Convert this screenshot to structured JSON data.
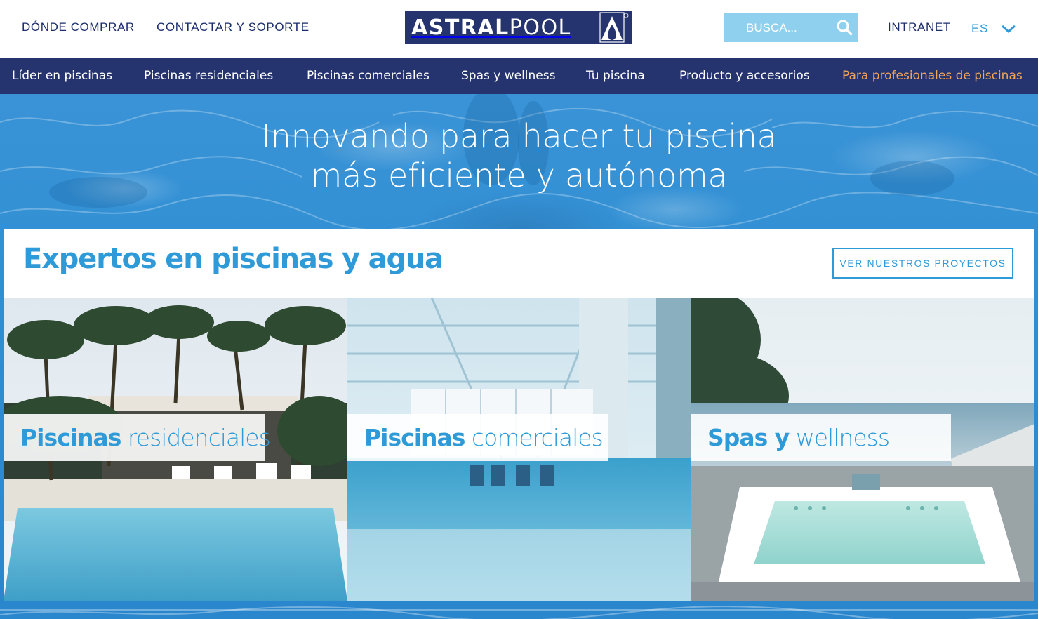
{
  "header": {
    "where_to_buy": "DÓNDE COMPRAR",
    "contact": "CONTACTAR Y SOPORTE",
    "logo": {
      "word_bold": "ASTRAL",
      "word_light": "POOL"
    },
    "search": {
      "placeholder": "BUSCA...",
      "icon": "search-icon"
    },
    "intranet": "INTRANET",
    "language": {
      "selected": "ES",
      "icon": "chevron-down-icon"
    }
  },
  "nav": {
    "items": [
      {
        "label": "Líder en piscinas"
      },
      {
        "label": "Piscinas residenciales"
      },
      {
        "label": "Piscinas comerciales"
      },
      {
        "label": "Spas y wellness"
      },
      {
        "label": "Tu piscina"
      },
      {
        "label": "Producto y accesorios"
      },
      {
        "label": "Para profesionales de piscinas"
      }
    ]
  },
  "hero": {
    "title_line1": "Innovando para hacer tu piscina",
    "title_line2": "más eficiente y autónoma"
  },
  "experts": {
    "title": "Expertos en piscinas y agua",
    "button": "VER NUESTROS PROYECTOS"
  },
  "tiles": [
    {
      "bold": "Piscinas",
      "light": "residenciales"
    },
    {
      "bold": "Piscinas",
      "light": "comerciales"
    },
    {
      "bold": "Spas y",
      "light": "wellness"
    }
  ],
  "colors": {
    "brand_navy": "#25346f",
    "accent_blue": "#2f9ad8",
    "search_bg": "#8fd0ee",
    "pro_orange": "#f2a659",
    "water_blue": "#3a93d6"
  }
}
